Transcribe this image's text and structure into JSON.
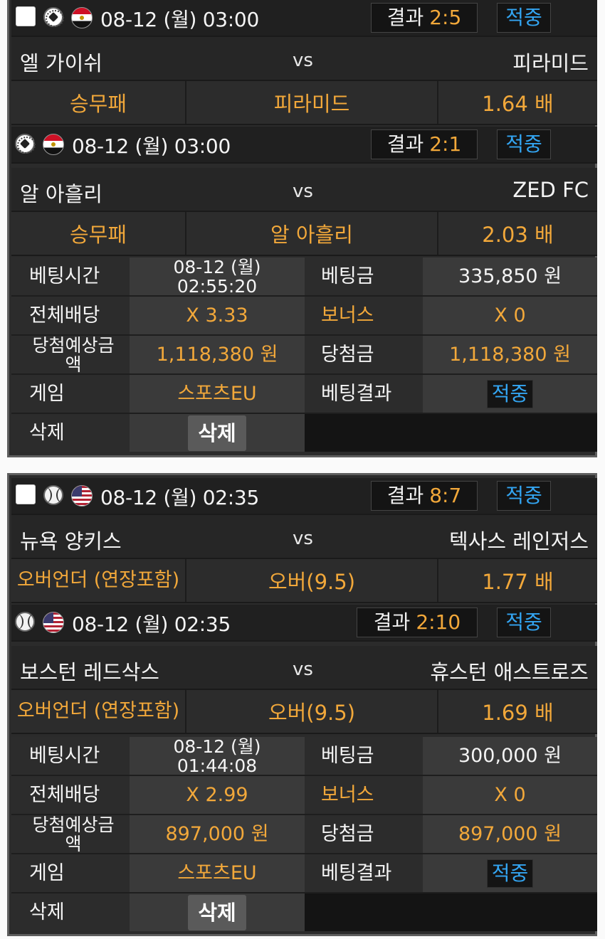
{
  "cards": [
    {
      "games": [
        {
          "date": "08-12 (월) 03:00",
          "result_label": "결과",
          "score": "2:5",
          "status": "적중",
          "home": "엘 가이쉬",
          "vs": "vs",
          "away": "피라미드",
          "bet_type": "승무패",
          "pick": "피라미드",
          "odds": "1.64 배",
          "sport_icon": "soccer-ball-icon",
          "flag_icon": "egypt-flag-icon"
        },
        {
          "date": "08-12 (월) 03:00",
          "result_label": "결과",
          "score": "2:1",
          "status": "적중",
          "home": "알 아흘리",
          "vs": "vs",
          "away": "ZED FC",
          "bet_type": "승무패",
          "pick": "알 아흘리",
          "odds": "2.03 배",
          "sport_icon": "soccer-ball-icon",
          "flag_icon": "egypt-flag-icon"
        }
      ],
      "summary": {
        "bet_time_label": "베팅시간",
        "bet_time_date": "08-12 (월)",
        "bet_time_clock": "02:55:20",
        "bet_amount_label": "베팅금",
        "bet_amount": "335,850 원",
        "total_odds_label": "전체배당",
        "total_odds": "X 3.33",
        "bonus_label": "보너스",
        "bonus": "X 0",
        "expected_label": "당첨예상금액",
        "expected": "1,118,380 원",
        "win_label": "당첨금",
        "win": "1,118,380 원",
        "game_label": "게임",
        "game": "스포츠EU",
        "bet_result_label": "베팅결과",
        "bet_result": "적중",
        "delete_label": "삭제",
        "delete_button": "삭제"
      }
    },
    {
      "games": [
        {
          "date": "08-12 (월) 02:35",
          "result_label": "결과",
          "score": "8:7",
          "status": "적중",
          "home": "뉴욕 양키스",
          "vs": "vs",
          "away": "텍사스 레인저스",
          "bet_type": "오버언더 (연장포함)",
          "pick": "오버(9.5)",
          "odds": "1.77 배",
          "sport_icon": "baseball-icon",
          "flag_icon": "usa-flag-icon"
        },
        {
          "date": "08-12 (월) 02:35",
          "result_label": "결과",
          "score": "2:10",
          "status": "적중",
          "home": "보스턴 레드삭스",
          "vs": "vs",
          "away": "휴스턴 애스트로즈",
          "bet_type": "오버언더 (연장포함)",
          "pick": "오버(9.5)",
          "odds": "1.69 배",
          "sport_icon": "baseball-icon",
          "flag_icon": "usa-flag-icon"
        }
      ],
      "summary": {
        "bet_time_label": "베팅시간",
        "bet_time_date": "08-12 (월)",
        "bet_time_clock": "01:44:08",
        "bet_amount_label": "베팅금",
        "bet_amount": "300,000 원",
        "total_odds_label": "전체배당",
        "total_odds": "X 2.99",
        "bonus_label": "보너스",
        "bonus": "X 0",
        "expected_label": "당첨예상금액",
        "expected": "897,000 원",
        "win_label": "당첨금",
        "win": "897,000 원",
        "game_label": "게임",
        "game": "스포츠EU",
        "bet_result_label": "베팅결과",
        "bet_result": "적중",
        "delete_label": "삭제",
        "delete_button": "삭제"
      }
    }
  ],
  "colors": {
    "accent_orange": "#f2a83a",
    "accent_blue": "#33a5f2",
    "panel": "#2b2b2b"
  }
}
